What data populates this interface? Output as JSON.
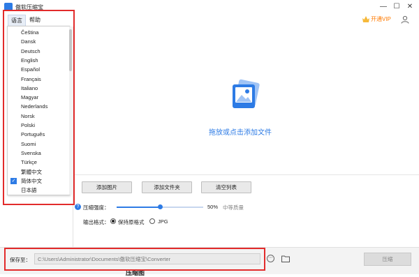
{
  "app": {
    "title": "傲软压缩宝"
  },
  "window_controls": {
    "minimize": "—",
    "maximize": "☐",
    "close": "✕"
  },
  "menu": {
    "language": "语言",
    "help": "帮助"
  },
  "header": {
    "vip": "开通VIP"
  },
  "languages": [
    {
      "label": "Čeština",
      "selected": false
    },
    {
      "label": "Dansk",
      "selected": false
    },
    {
      "label": "Deutsch",
      "selected": false
    },
    {
      "label": "English",
      "selected": false
    },
    {
      "label": "Español",
      "selected": false
    },
    {
      "label": "Français",
      "selected": false
    },
    {
      "label": "Italiano",
      "selected": false
    },
    {
      "label": "Magyar",
      "selected": false
    },
    {
      "label": "Nederlands",
      "selected": false
    },
    {
      "label": "Norsk",
      "selected": false
    },
    {
      "label": "Polski",
      "selected": false
    },
    {
      "label": "Português",
      "selected": false
    },
    {
      "label": "Suomi",
      "selected": false
    },
    {
      "label": "Svenska",
      "selected": false
    },
    {
      "label": "Türkçe",
      "selected": false
    },
    {
      "label": "繁體中文",
      "selected": false
    },
    {
      "label": "简体中文",
      "selected": true
    },
    {
      "label": "日本語",
      "selected": false
    }
  ],
  "drop_area": {
    "text": "拖放或点击添加文件"
  },
  "buttons": {
    "add_image": "添加图片",
    "add_folder": "添加文件夹",
    "clear_list": "清空列表"
  },
  "compression": {
    "label": "压缩强度：",
    "value": "50%",
    "value_fraction": 0.5,
    "quality": "中等质量"
  },
  "output_format": {
    "label": "输出格式：",
    "keep_original": "保持原格式",
    "jpg": "JPG",
    "selected": "keep_original"
  },
  "save": {
    "label": "保存至：",
    "path": "C:\\Users\\Administrator\\Documents\\傲软压缩宝\\Converter",
    "more": "⋯",
    "compress": "压缩"
  },
  "partial_text": "压缩图",
  "colors": {
    "accent": "#2d7be5",
    "highlight": "#e22b2b",
    "vip": "#ff7a00"
  }
}
